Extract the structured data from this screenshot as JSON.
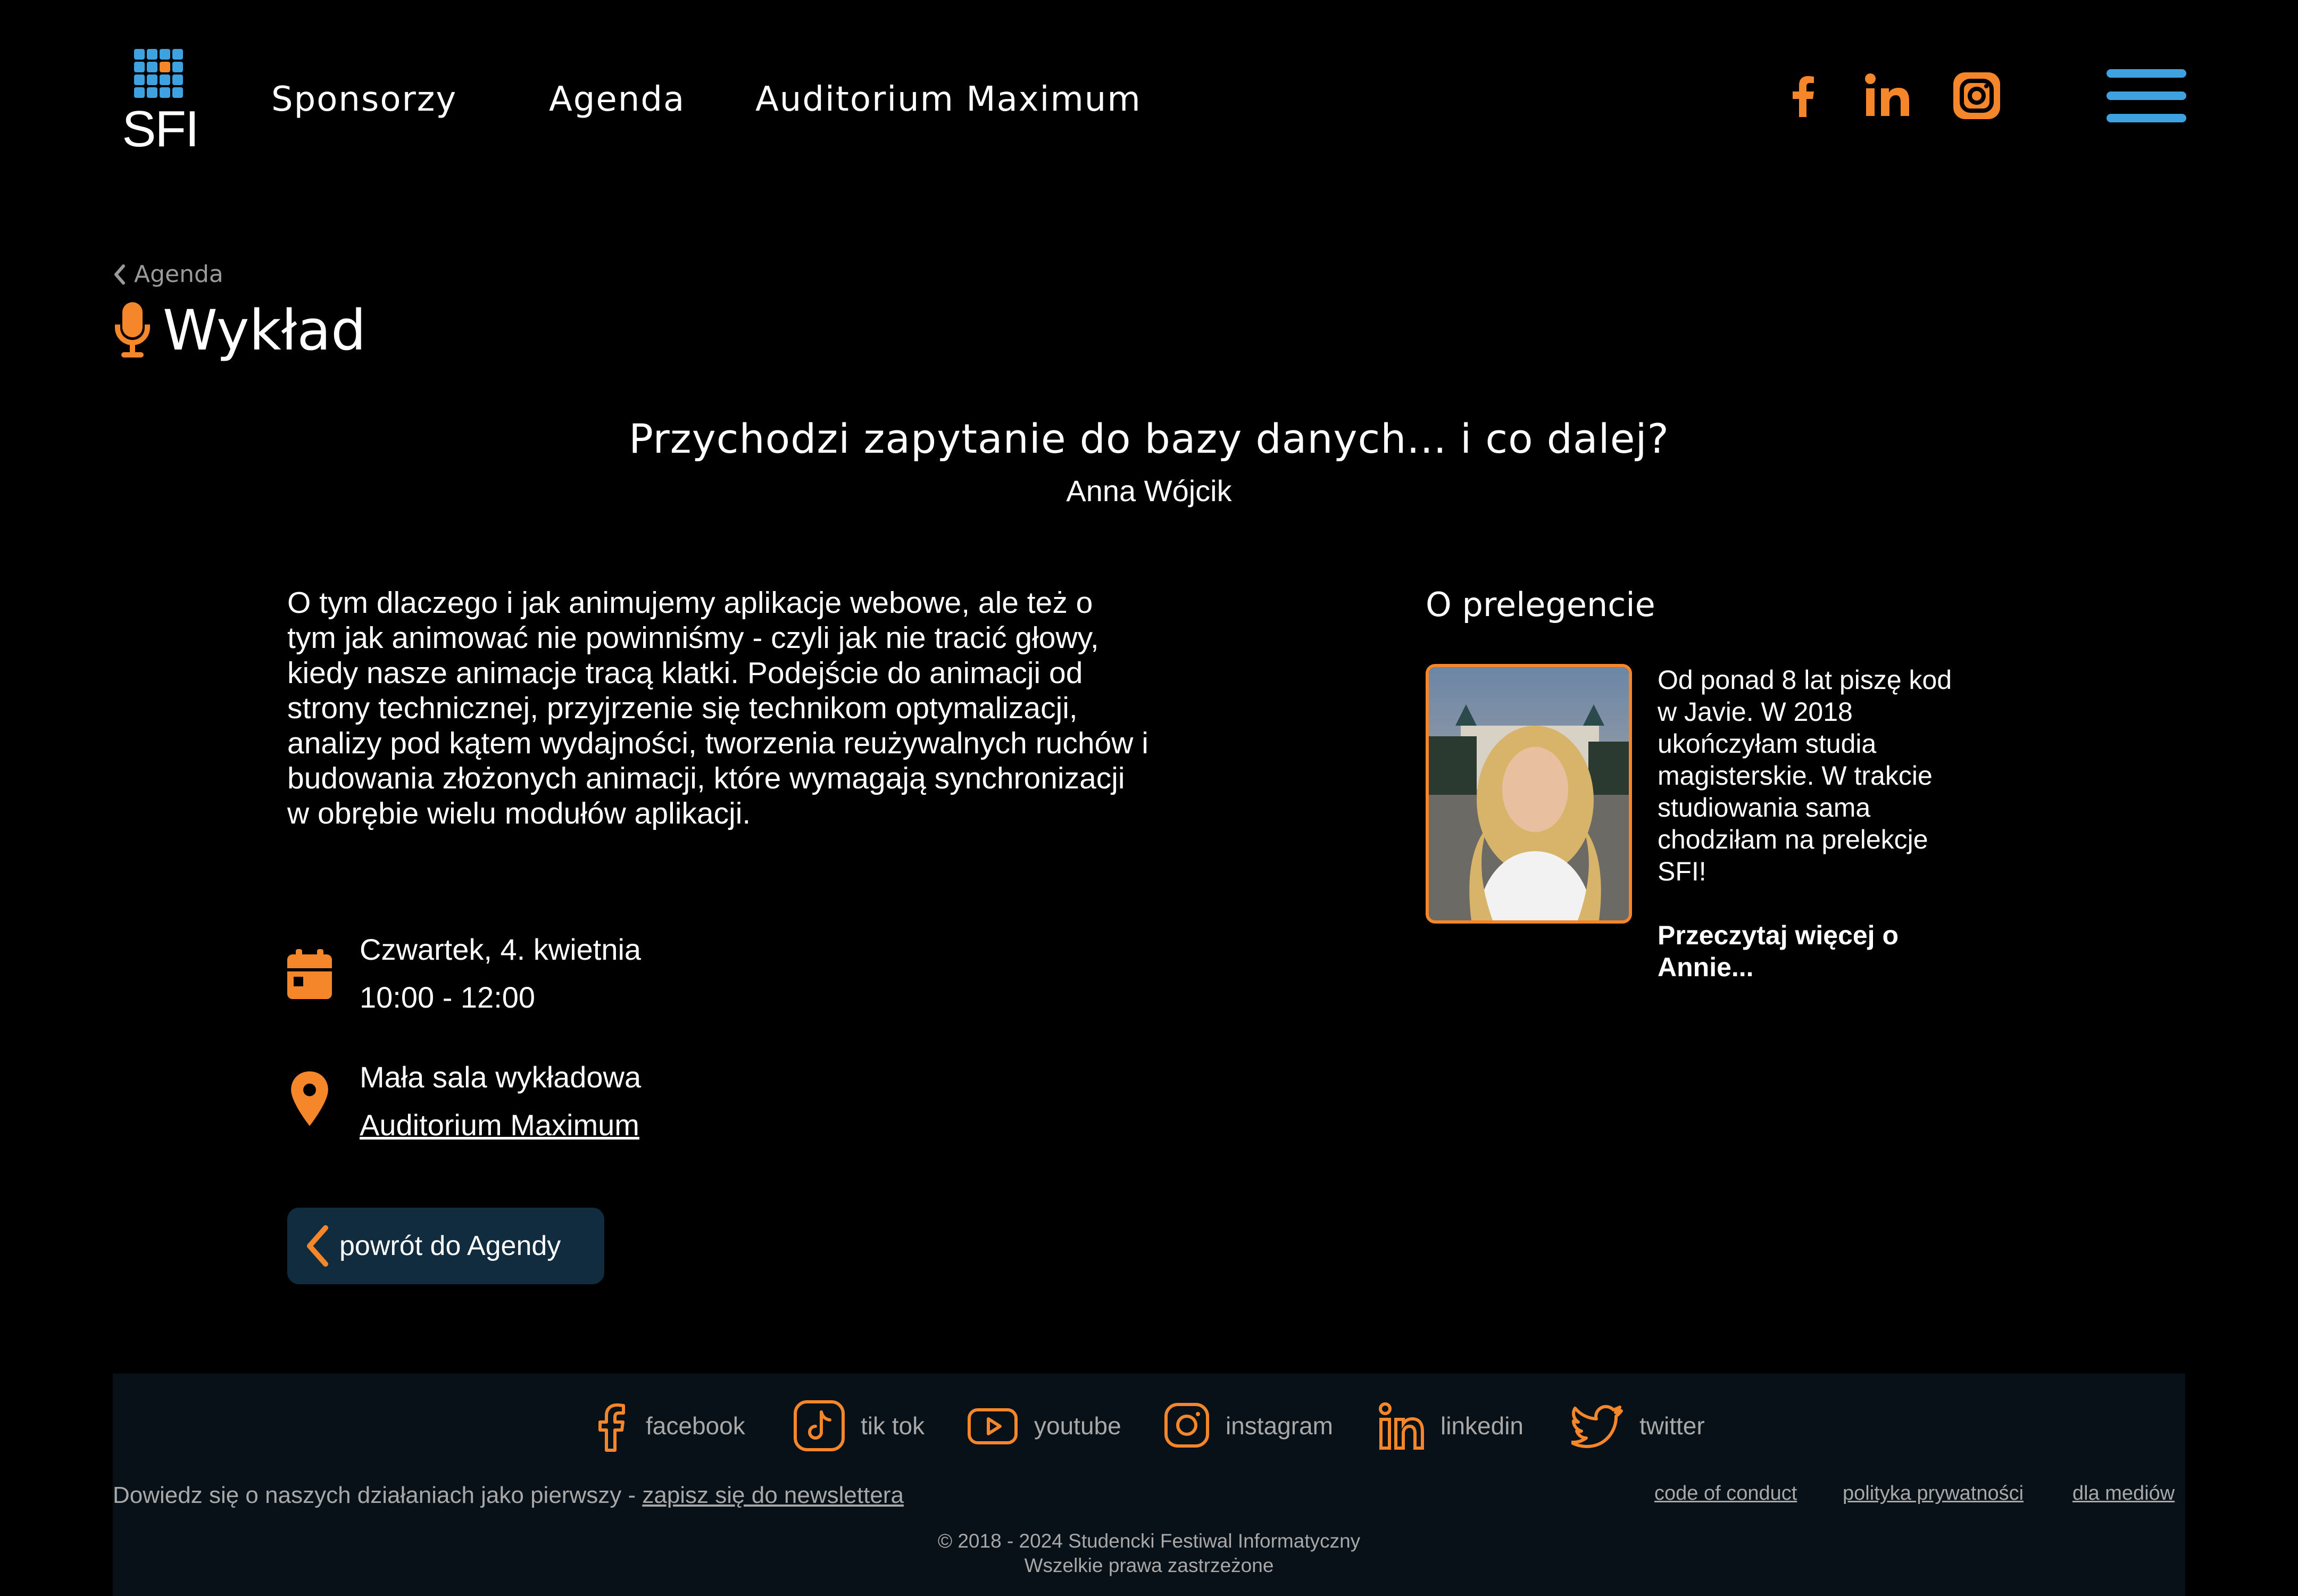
{
  "header": {
    "logo_text": "SFI",
    "nav": [
      "Sponsorzy",
      "Agenda",
      "Auditorium Maximum"
    ],
    "social_icons": [
      "facebook-icon",
      "linkedin-icon",
      "instagram-icon"
    ],
    "menu_icon": "hamburger-menu-icon"
  },
  "breadcrumb": {
    "label": "Agenda"
  },
  "page": {
    "type_label": "Wykład",
    "talk_title": "Przychodzi zapytanie do bazy danych... i co dalej?",
    "speaker": "Anna Wójcik",
    "description": "O tym dlaczego i jak animujemy aplikacje webowe, ale też o tym jak animować nie powinniśmy - czyli jak nie tracić głowy, kiedy nasze animacje tracą klatki. Podejście do animacji od strony technicznej, przyjrzenie się technikom optymalizacji, analizy pod kątem wydajności, tworzenia reużywalnych ruchów i budowania złożonych animacji, które wymagają synchronizacji w obrębie wielu modułów aplikacji.",
    "date": "Czwartek, 4. kwietnia",
    "time": "10:00 - 12:00",
    "room": "Mała sala wykładowa",
    "venue_link": "Auditorium Maximum",
    "back_button": "powrót do Agendy"
  },
  "about": {
    "heading": "O prelegencie",
    "bio": "Od ponad 8 lat piszę kod w Javie. W 2018 ukończyłam studia magisterskie. W trakcie studiowania sama chodziłam na prelekcje SFI!",
    "more_link": "Przeczytaj więcej o Annie..."
  },
  "footer": {
    "social": [
      {
        "label": "facebook",
        "icon": "facebook-icon"
      },
      {
        "label": "tik tok",
        "icon": "tiktok-icon"
      },
      {
        "label": "youtube",
        "icon": "youtube-icon"
      },
      {
        "label": "instagram",
        "icon": "instagram-icon"
      },
      {
        "label": "linkedin",
        "icon": "linkedin-icon"
      },
      {
        "label": "twitter",
        "icon": "twitter-icon"
      }
    ],
    "newsletter_text": "Dowiedz się o naszych działaniach jako pierwszy - ",
    "newsletter_link": "zapisz się do newslettera",
    "links": [
      "code of conduct",
      "polityka prywatności",
      "dla mediów"
    ],
    "copyright": "© 2018 - 2024 Studencki Festiwal Informatyczny",
    "rights": "Wszelkie prawa zastrzeżone"
  },
  "colors": {
    "accent_orange": "#f5862a",
    "accent_blue": "#3fa2e0",
    "button_bg": "#122c3f",
    "footer_bg": "#081117"
  }
}
